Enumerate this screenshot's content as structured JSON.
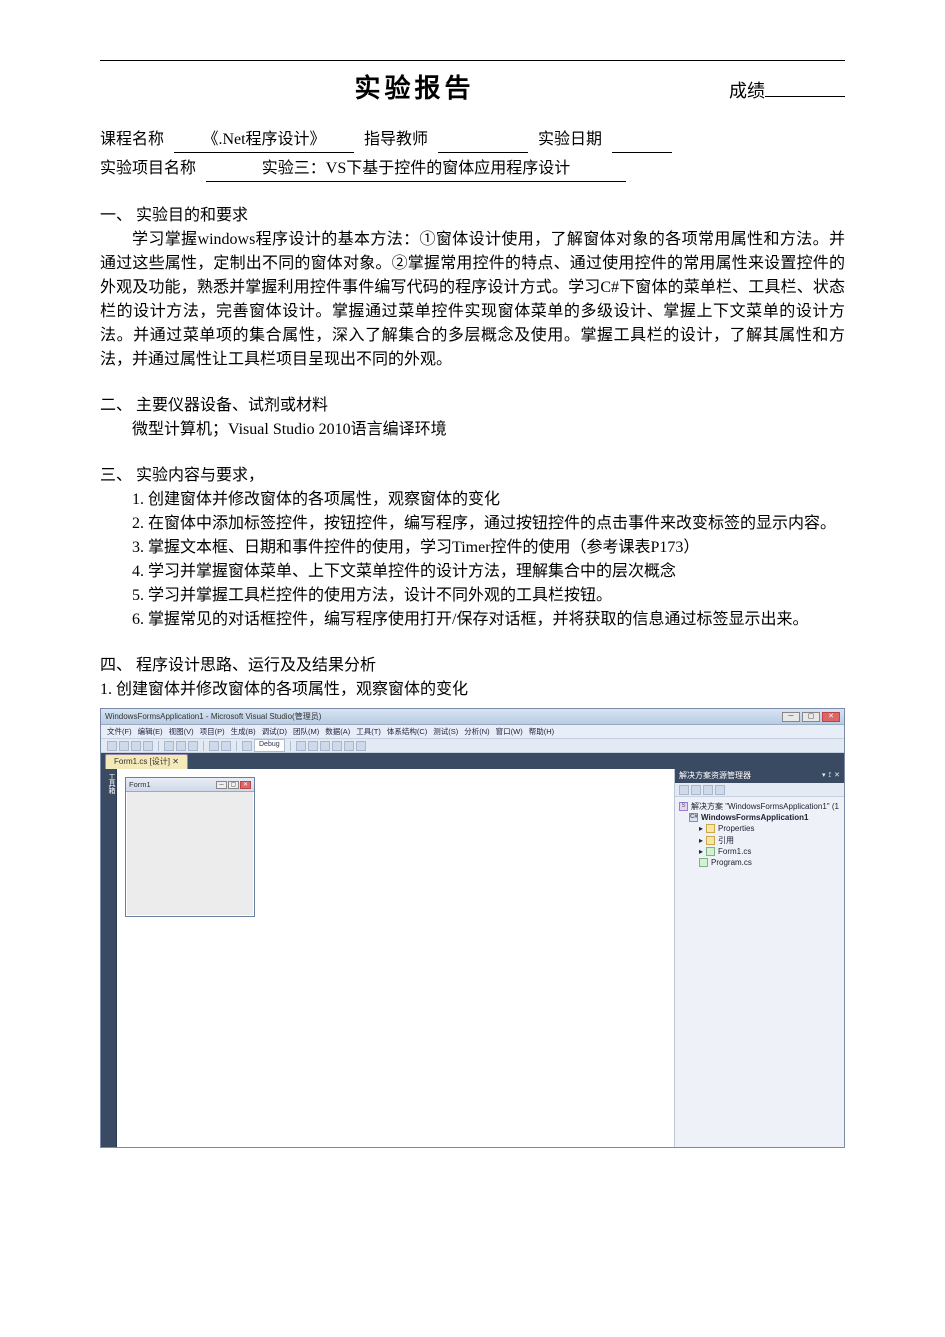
{
  "header": {
    "title": "实验报告",
    "score_label": "成绩"
  },
  "meta": {
    "course_label": "课程名称",
    "course_value": "《.Net程序设计》",
    "teacher_label": "指导教师",
    "teacher_value": "",
    "date_label": "实验日期",
    "date_value": "",
    "project_label": "实验项目名称",
    "project_value": "实验三：VS下基于控件的窗体应用程序设计"
  },
  "sections": {
    "s1": {
      "head": "一、 实验目的和要求",
      "body": "学习掌握windows程序设计的基本方法：①窗体设计使用，了解窗体对象的各项常用属性和方法。并通过这些属性，定制出不同的窗体对象。②掌握常用控件的特点、通过使用控件的常用属性来设置控件的外观及功能，熟悉并掌握利用控件事件编写代码的程序设计方式。学习C#下窗体的菜单栏、工具栏、状态栏的设计方法，完善窗体设计。掌握通过菜单控件实现窗体菜单的多级设计、掌握上下文菜单的设计方法。并通过菜单项的集合属性，深入了解集合的多层概念及使用。掌握工具栏的设计，了解其属性和方法，并通过属性让工具栏项目呈现出不同的外观。"
    },
    "s2": {
      "head": "二、 主要仪器设备、试剂或材料",
      "body": "微型计算机；Visual Studio 2010语言编译环境"
    },
    "s3": {
      "head": "三、 实验内容与要求，",
      "items": [
        "1. 创建窗体并修改窗体的各项属性，观察窗体的变化",
        "2. 在窗体中添加标签控件，按钮控件，编写程序，通过按钮控件的点击事件来改变标签的显示内容。",
        "3. 掌握文本框、日期和事件控件的使用，学习Timer控件的使用（参考课表P173）",
        "4. 学习并掌握窗体菜单、上下文菜单控件的设计方法，理解集合中的层次概念",
        "5. 学习并掌握工具栏控件的使用方法，设计不同外观的工具栏按钮。",
        "6. 掌握常见的对话框控件，编写程序使用打开/保存对话框，并将获取的信息通过标签显示出来。"
      ]
    },
    "s4": {
      "head": "四、 程序设计思路、运行及及结果分析",
      "sub1": "1. 创建窗体并修改窗体的各项属性，观察窗体的变化"
    }
  },
  "ide": {
    "window_title": "WindowsFormsApplication1 - Microsoft Visual Studio(管理员)",
    "menus": [
      "文件(F)",
      "编辑(E)",
      "视图(V)",
      "项目(P)",
      "生成(B)",
      "调试(D)",
      "团队(M)",
      "数据(A)",
      "工具(T)",
      "体系结构(C)",
      "测试(S)",
      "分析(N)",
      "窗口(W)",
      "帮助(H)"
    ],
    "config": "Debug",
    "tab": "Form1.cs [设计]",
    "toolbox_label": "工具箱",
    "form_title": "Form1",
    "solution_panel_title": "解决方案资源管理器",
    "tree": {
      "solution": "解决方案 \"WindowsFormsApplication1\" (1",
      "project": "WindowsFormsApplication1",
      "nodes": [
        "Properties",
        "引用",
        "Form1.cs",
        "Program.cs"
      ]
    }
  }
}
